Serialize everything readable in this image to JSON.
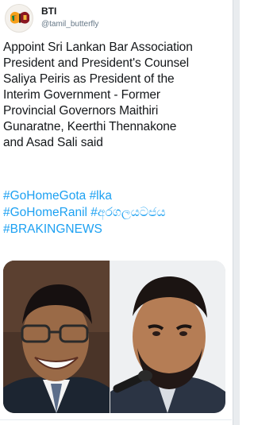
{
  "tweet": {
    "display_name": "BTI",
    "handle": "@tamil_butterfly",
    "text_lines": [
      "Appoint Sri Lankan Bar Association",
      "President and President's Counsel",
      "Saliya Peiris as President of the",
      "Interim Government - Former",
      "Provincial Governors Maithiri",
      "Gunaratne, Keerthi Thennakone",
      "and Asad Sali said"
    ],
    "hashtags": [
      "#GoHomeGota",
      "#lka",
      "#GoHomeRanil",
      "#අරගලයටජය",
      "#BRAKINGNEWS"
    ]
  },
  "media": {
    "left_photo_icon": "portrait-smiling-man-glasses",
    "right_photo_icon": "portrait-bearded-man-microphone"
  },
  "colors": {
    "text": "#14171a",
    "handle": "#657786",
    "link": "#1da1f2"
  }
}
